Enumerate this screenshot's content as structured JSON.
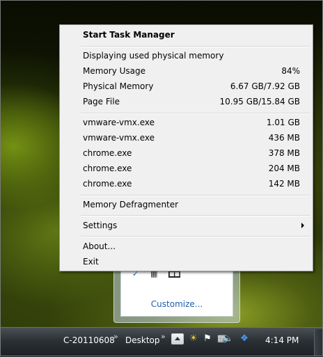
{
  "menu": {
    "start_task_manager": "Start Task Manager",
    "displaying": "Displaying used physical memory",
    "stats": [
      {
        "label": "Memory Usage",
        "value": "84%"
      },
      {
        "label": "Physical Memory",
        "value": "6.67 GB/7.92 GB"
      },
      {
        "label": "Page File",
        "value": "10.95 GB/15.84 GB"
      }
    ],
    "processes": [
      {
        "name": "vmware-vmx.exe",
        "memory": "1.01 GB"
      },
      {
        "name": "vmware-vmx.exe",
        "memory": "436 MB"
      },
      {
        "name": "chrome.exe",
        "memory": "378 MB"
      },
      {
        "name": "chrome.exe",
        "memory": "204 MB"
      },
      {
        "name": "chrome.exe",
        "memory": "142 MB"
      }
    ],
    "memory_defragmenter": "Memory Defragmenter",
    "settings": "Settings",
    "about": "About...",
    "exit": "Exit"
  },
  "tray_flyout": {
    "customize": "Customize...",
    "icons": [
      "bluetooth-icon",
      "network-icon",
      "notification-badge-icon"
    ]
  },
  "taskbar": {
    "toolbar_computer": "C-20110608",
    "toolbar_desktop": "Desktop",
    "chevron": "»",
    "tray_icons": [
      "weather-sun-icon",
      "action-center-icon",
      "network-icon",
      "volume-icon",
      "dropbox-icon"
    ],
    "clock": "4:14 PM"
  },
  "colors": {
    "menu_background": "#f0f0f0",
    "link_blue": "#1c5fa8",
    "taskbar_dark": "#1c2024"
  }
}
